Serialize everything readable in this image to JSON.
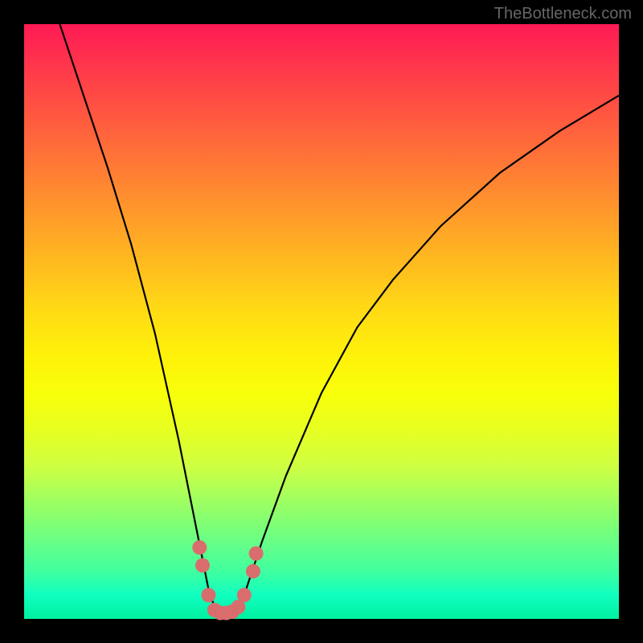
{
  "watermark": "TheBottleneck.com",
  "chart_data": {
    "type": "line",
    "title": "",
    "xlabel": "",
    "ylabel": "",
    "xlim": [
      0,
      100
    ],
    "ylim": [
      0,
      100
    ],
    "series": [
      {
        "name": "bottleneck-curve",
        "x": [
          6,
          10,
          14,
          18,
          22,
          26,
          28,
          30,
          31,
          32,
          33,
          34,
          35,
          36,
          37,
          38,
          40,
          44,
          50,
          56,
          62,
          70,
          80,
          90,
          100
        ],
        "y": [
          100,
          88,
          76,
          63,
          48,
          30,
          20,
          10,
          5,
          2,
          1,
          1,
          1,
          2,
          4,
          7,
          13,
          24,
          38,
          49,
          57,
          66,
          75,
          82,
          88
        ]
      }
    ],
    "markers": {
      "name": "highlight-dots",
      "color": "#d96d6d",
      "points": [
        {
          "x": 29.5,
          "y": 12
        },
        {
          "x": 30.0,
          "y": 9
        },
        {
          "x": 31.0,
          "y": 4
        },
        {
          "x": 32.0,
          "y": 1.5
        },
        {
          "x": 33.0,
          "y": 1
        },
        {
          "x": 34.0,
          "y": 1
        },
        {
          "x": 35.0,
          "y": 1.2
        },
        {
          "x": 36.0,
          "y": 2
        },
        {
          "x": 37.0,
          "y": 4
        },
        {
          "x": 38.5,
          "y": 8
        },
        {
          "x": 39.0,
          "y": 11
        }
      ]
    }
  }
}
